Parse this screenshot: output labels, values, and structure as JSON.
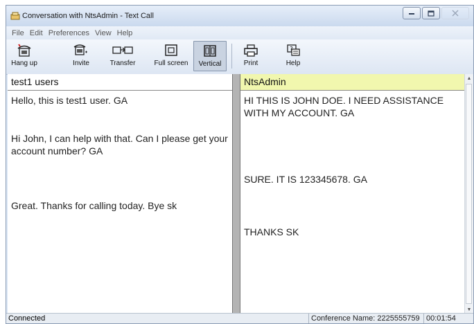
{
  "window": {
    "title": "Conversation with NtsAdmin - Text Call"
  },
  "menu": [
    "File",
    "Edit",
    "Preferences",
    "View",
    "Help"
  ],
  "toolbar": {
    "hangup": "Hang up",
    "invite": "Invite",
    "transfer": "Transfer",
    "fullscreen": "Full screen",
    "vertical": "Vertical",
    "print": "Print",
    "help": "Help"
  },
  "left_pane": {
    "header": "test1 users",
    "messages": [
      "Hello, this is test1 user.  GA",
      "Hi John, I can help with that.  Can I please get your account number? GA",
      "Great.  Thanks for calling today.  Bye sk"
    ]
  },
  "right_pane": {
    "header": "NtsAdmin",
    "messages": [
      "HI THIS IS JOHN DOE. I NEED ASSISTANCE WITH MY ACCOUNT. GA",
      "SURE.  IT IS 123345678.  GA",
      "THANKS SK"
    ]
  },
  "status": {
    "state": "Connected",
    "conference": "Conference Name: 2225555759",
    "timer": "00:01:54"
  }
}
